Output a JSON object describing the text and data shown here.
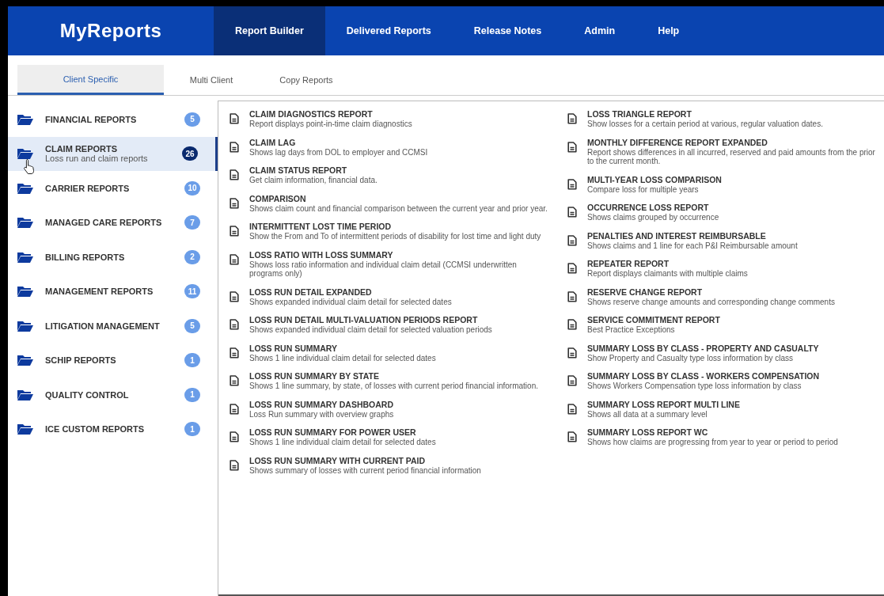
{
  "app": {
    "logo": "MyReports"
  },
  "nav": [
    {
      "label": "Report Builder",
      "selected": true
    },
    {
      "label": "Delivered Reports",
      "selected": false
    },
    {
      "label": "Release Notes",
      "selected": false
    },
    {
      "label": "Admin",
      "selected": false
    },
    {
      "label": "Help",
      "selected": false
    }
  ],
  "tabs": [
    {
      "label": "Client Specific",
      "selected": true
    },
    {
      "label": "Multi Client",
      "selected": false
    },
    {
      "label": "Copy Reports",
      "selected": false
    }
  ],
  "sidebar": {
    "items": [
      {
        "label": "FINANCIAL REPORTS",
        "count": "5",
        "selected": false
      },
      {
        "label": "CLAIM REPORTS",
        "subtitle": "Loss run and claim reports",
        "count": "26",
        "selected": true
      },
      {
        "label": "CARRIER REPORTS",
        "count": "10",
        "selected": false
      },
      {
        "label": "MANAGED CARE REPORTS",
        "count": "7",
        "selected": false
      },
      {
        "label": "BILLING REPORTS",
        "count": "2",
        "selected": false
      },
      {
        "label": "MANAGEMENT REPORTS",
        "count": "11",
        "selected": false
      },
      {
        "label": "LITIGATION MANAGEMENT",
        "count": "5",
        "selected": false
      },
      {
        "label": "SCHIP REPORTS",
        "count": "1",
        "selected": false
      },
      {
        "label": "QUALITY CONTROL",
        "count": "1",
        "selected": false
      },
      {
        "label": "ICE CUSTOM REPORTS",
        "count": "1",
        "selected": false
      }
    ]
  },
  "reports": {
    "columns": [
      [
        {
          "title": "CLAIM DIAGNOSTICS REPORT",
          "description": "Report displays point-in-time claim diagnostics"
        },
        {
          "title": "CLAIM LAG",
          "description": "Shows lag days from DOL to employer and CCMSI"
        },
        {
          "title": "CLAIM STATUS REPORT",
          "description": "Get claim information, financial data."
        },
        {
          "title": "COMPARISON",
          "description": "Shows claim count and financial comparison between the current year and prior year."
        },
        {
          "title": "INTERMITTENT LOST TIME PERIOD",
          "description": "Show the From and To of intermittent periods of disability for lost time and light duty"
        },
        {
          "title": "LOSS RATIO WITH LOSS SUMMARY",
          "description": "Shows loss ratio information and individual claim detail (CCMSI underwritten programs only)"
        },
        {
          "title": "LOSS RUN DETAIL EXPANDED",
          "description": "Shows expanded individual claim detail for selected dates"
        },
        {
          "title": "LOSS RUN DETAIL MULTI-VALUATION PERIODS REPORT",
          "description": "Shows expanded individual claim detail for selected valuation periods"
        },
        {
          "title": "LOSS RUN SUMMARY",
          "description": "Shows 1 line individual claim detail for selected dates"
        },
        {
          "title": "LOSS RUN SUMMARY BY STATE",
          "description": "Shows 1 line summary, by state, of losses with current period financial information."
        },
        {
          "title": "LOSS RUN SUMMARY DASHBOARD",
          "description": "Loss Run summary with overview graphs"
        },
        {
          "title": "LOSS RUN SUMMARY FOR POWER USER",
          "description": "Shows 1 line individual claim detail for selected dates"
        },
        {
          "title": "LOSS RUN SUMMARY WITH CURRENT PAID",
          "description": "Shows summary of losses with current period financial information"
        }
      ],
      [
        {
          "title": "LOSS TRIANGLE REPORT",
          "description": "Show losses for a certain period at various, regular valuation dates."
        },
        {
          "title": "MONTHLY DIFFERENCE REPORT EXPANDED",
          "description": "Report shows differences in all incurred, reserved and paid amounts from the prior to the current month."
        },
        {
          "title": "MULTI-YEAR LOSS COMPARISON",
          "description": "Compare loss for multiple years"
        },
        {
          "title": "OCCURRENCE LOSS REPORT",
          "description": "Shows claims grouped by occurrence"
        },
        {
          "title": "PENALTIES AND INTEREST REIMBURSABLE",
          "description": "Shows claims and 1 line for each P&I Reimbursable amount"
        },
        {
          "title": "REPEATER REPORT",
          "description": "Report displays claimants with multiple claims"
        },
        {
          "title": "RESERVE CHANGE REPORT",
          "description": "Shows reserve change amounts and corresponding change comments"
        },
        {
          "title": "SERVICE COMMITMENT REPORT",
          "description": "Best Practice Exceptions"
        },
        {
          "title": "SUMMARY LOSS BY CLASS - PROPERTY AND CASUALTY",
          "description": "Show Property and Casualty type loss information by class"
        },
        {
          "title": "SUMMARY LOSS BY CLASS - WORKERS COMPENSATION",
          "description": "Shows Workers Compensation type loss information by class"
        },
        {
          "title": "SUMMARY LOSS REPORT MULTI LINE",
          "description": "Shows all data at a summary level"
        },
        {
          "title": "SUMMARY LOSS REPORT WC",
          "description": "Shows how claims are progressing from year to year or period to period"
        }
      ]
    ]
  }
}
